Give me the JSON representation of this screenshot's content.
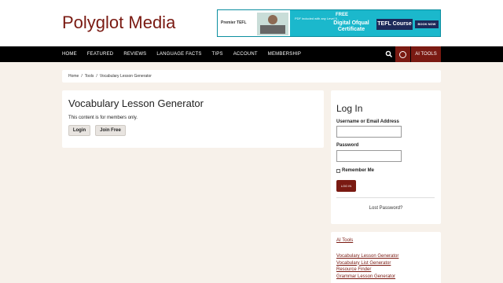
{
  "header": {
    "site_title": "Polyglot Media",
    "banner": {
      "logo_text": "Premier TEFL",
      "line1": "FREE",
      "line2": "PDF included with any Level 5",
      "line3": "Digital Ofqual Certificate",
      "course": "TEFL Course",
      "cta": "BOOK NOW"
    }
  },
  "nav": {
    "items": [
      "HOME",
      "FEATURED",
      "REVIEWS",
      "LANGUAGE FACTS",
      "TIPS",
      "ACCOUNT",
      "MEMBERSHIP"
    ],
    "ai_tools": "AI TOOLS"
  },
  "breadcrumb": {
    "items": [
      "Home",
      "Tools",
      "Vocabulary Lesson Generator"
    ],
    "separator": "/"
  },
  "main": {
    "title": "Vocabulary Lesson Generator",
    "message": "This content is for members only.",
    "login_label": "Login",
    "join_label": "Join Free"
  },
  "login_widget": {
    "title": "Log In",
    "username_label": "Username or Email Address",
    "password_label": "Password",
    "remember_label": "Remember Me",
    "submit_label": "LOG IN",
    "lost_password": "Lost Password?"
  },
  "tools_widget": {
    "heading": "AI Tools",
    "links": [
      "Vocabulary Lesson Generator",
      "Vocabulary List Generator",
      "Resource Finder",
      "Grammar Lesson Generator"
    ]
  },
  "colors": {
    "brand": "#7a1a12",
    "nav_bg": "#000000",
    "page_bg": "#f7f1ea"
  }
}
